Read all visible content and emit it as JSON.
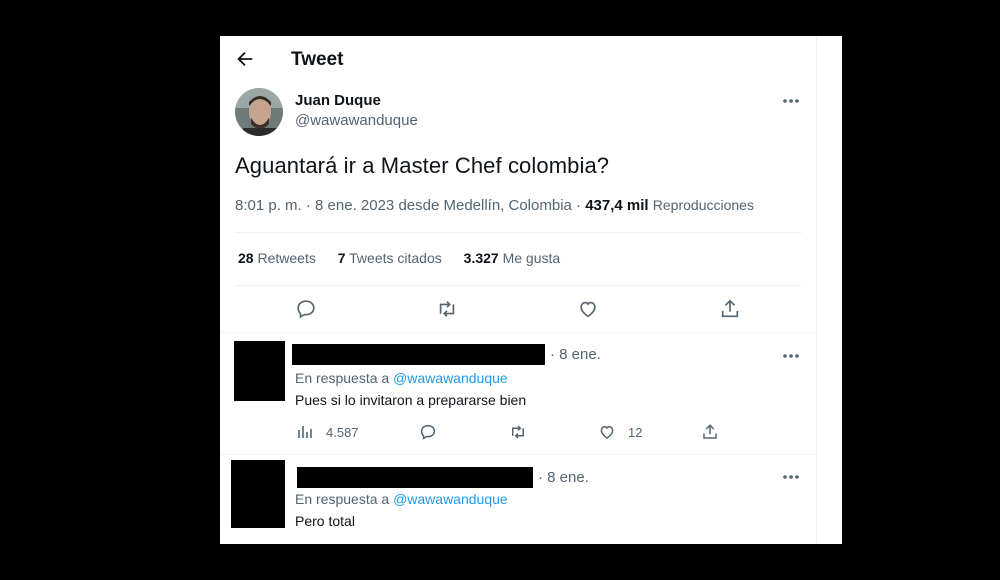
{
  "header": {
    "title": "Tweet"
  },
  "tweet": {
    "author_name": "Juan Duque",
    "author_handle": "@wawawanduque",
    "text": "Aguantará ir a Master Chef colombia?",
    "time": "8:01 p. m. · 8 ene. 2023 desde Medellín, Colombia ·",
    "views_count": "437,4 mil",
    "views_label": "Reproducciones",
    "stats": {
      "retweets_count": "28",
      "retweets_label": "Retweets",
      "quotes_count": "7",
      "quotes_label": "Tweets citados",
      "likes_count": "3.327",
      "likes_label": "Me gusta"
    }
  },
  "replies": [
    {
      "date": "· 8 ene.",
      "reply_prefix": "En respuesta a",
      "reply_to": "@wawawanduque",
      "text": "Pues si lo invitaron a prepararse  bien",
      "views": "4.587",
      "likes": "12"
    },
    {
      "date": "· 8 ene.",
      "reply_prefix": "En respuesta a",
      "reply_to": "@wawawanduque",
      "text": "Pero total"
    }
  ],
  "icons": [
    "back-arrow-icon",
    "more-icon",
    "reply-icon",
    "retweet-icon",
    "like-icon",
    "share-icon",
    "views-icon"
  ]
}
